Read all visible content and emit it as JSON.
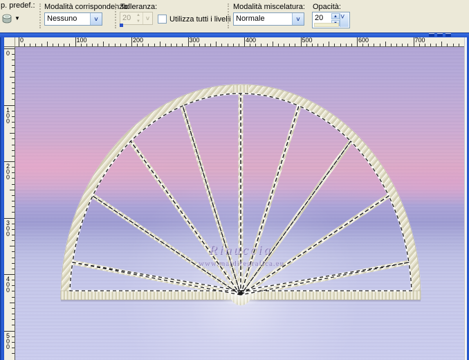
{
  "toolbar": {
    "preset_label": "p. predef.:",
    "match_mode_label": "Modalità corrispondenza:",
    "match_mode_value": "Nessuno",
    "tolerance_label": "Tolleranza:",
    "tolerance_value": "20",
    "all_layers_label": "Utilizza tutti i livelli",
    "all_layers_checked": false,
    "blend_mode_label": "Modalità miscelatura:",
    "blend_mode_value": "Normale",
    "opacity_label": "Opacità:",
    "opacity_value": "20"
  },
  "rulers": {
    "horizontal_labels": [
      "0",
      "100",
      "200",
      "300",
      "400",
      "500",
      "600",
      "700"
    ],
    "vertical_labels": [
      "0",
      "100",
      "200",
      "300",
      "400",
      "500"
    ],
    "units_per_label": 100
  },
  "canvas": {
    "watermark_line1": "Rinuccia",
    "watermark_line2": "www.maidiregrafica.eu"
  },
  "colors": {
    "window_chrome_blue": "#2456cc",
    "toolbar_bg": "#ece9d8",
    "frame_cream": "#e8e5d3",
    "sky_pink": "#dcabc7",
    "sky_lavender": "#b2a6d6",
    "sky_periwinkle": "#cbcdee",
    "selection_dash": "#1a1a1a"
  }
}
